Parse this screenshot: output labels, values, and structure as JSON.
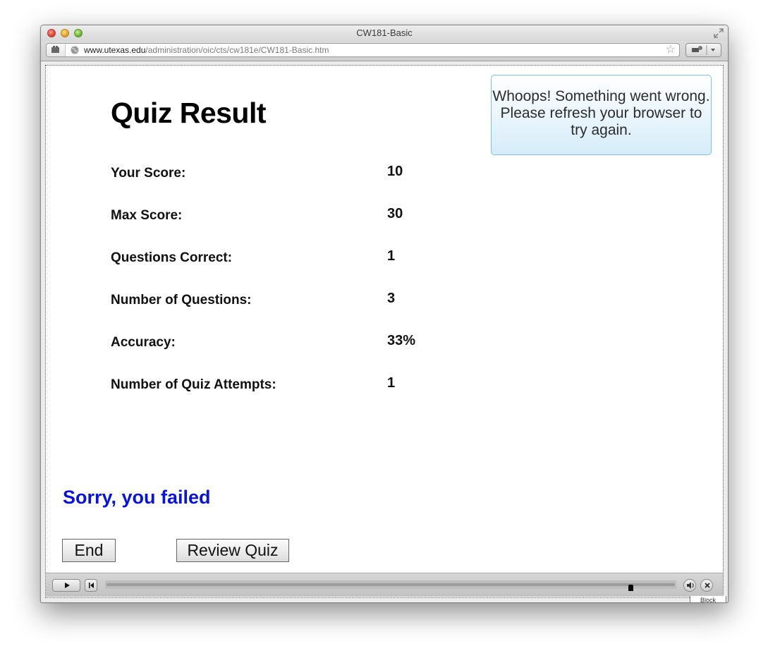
{
  "window": {
    "title": "CW181-Basic"
  },
  "address_bar": {
    "url_domain": "www.utexas.edu",
    "url_path": "/administration/oic/cts/cw181e/CW181-Basic.htm"
  },
  "quiz": {
    "title": "Quiz Result",
    "rows": [
      {
        "label": "Your Score:",
        "value": "10"
      },
      {
        "label": "Max Score:",
        "value": "30"
      },
      {
        "label": "Questions Correct:",
        "value": "1"
      },
      {
        "label": "Number of Questions:",
        "value": "3"
      },
      {
        "label": "Accuracy:",
        "value": "33%"
      },
      {
        "label": "Number of Quiz Attempts:",
        "value": "1"
      }
    ],
    "result_message": "Sorry, you failed",
    "end_label": "End",
    "review_label": "Review Quiz"
  },
  "error_bubble": {
    "text": "Whoops! Something went wrong. Please refresh your browser to try again."
  },
  "player": {
    "progress": 0.92
  },
  "block_tag": "Block",
  "colors": {
    "fail_text": "#0a14d6",
    "bubble_border": "#7dc1e6"
  }
}
